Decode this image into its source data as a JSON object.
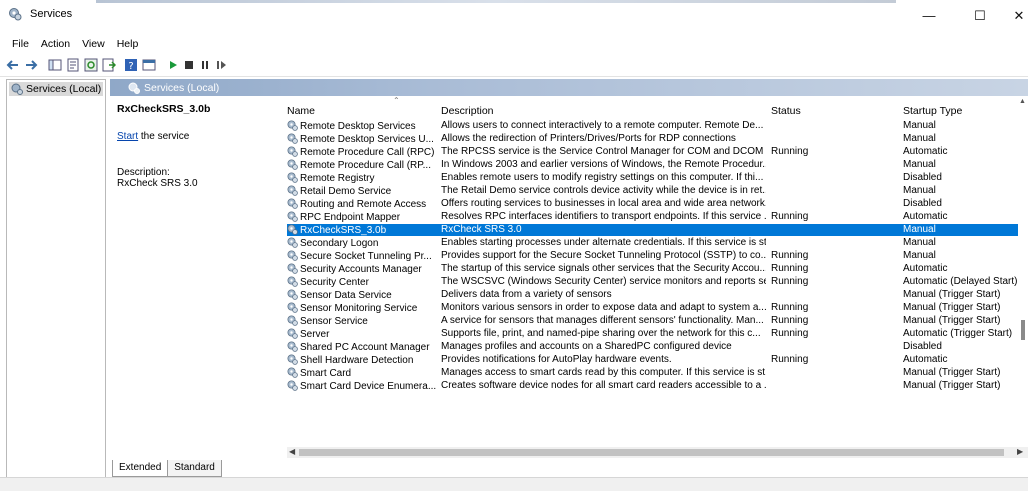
{
  "window": {
    "title": "Services"
  },
  "menu": [
    "File",
    "Action",
    "View",
    "Help"
  ],
  "tree": {
    "root": "Services (Local)"
  },
  "panel": {
    "header": "Services (Local)"
  },
  "details": {
    "service_name": "RxCheckSRS_3.0b",
    "action_link": "Start",
    "action_rest": " the service",
    "description_label": "Description:",
    "description_value": "RxCheck SRS 3.0"
  },
  "columns": {
    "name": "Name",
    "description": "Description",
    "status": "Status",
    "startup_type": "Startup Type"
  },
  "services": [
    {
      "name": "Remote Desktop Services",
      "description": "Allows users to connect interactively to a remote computer. Remote De...",
      "status": "",
      "startup": "Manual"
    },
    {
      "name": "Remote Desktop Services U...",
      "description": "Allows the redirection of Printers/Drives/Ports for RDP connections",
      "status": "",
      "startup": "Manual"
    },
    {
      "name": "Remote Procedure Call (RPC)",
      "description": "The RPCSS service is the Service Control Manager for COM and DCOM s...",
      "status": "Running",
      "startup": "Automatic"
    },
    {
      "name": "Remote Procedure Call (RP...",
      "description": "In Windows 2003 and earlier versions of Windows, the Remote Procedur...",
      "status": "",
      "startup": "Manual"
    },
    {
      "name": "Remote Registry",
      "description": "Enables remote users to modify registry settings on this computer. If thi...",
      "status": "",
      "startup": "Disabled"
    },
    {
      "name": "Retail Demo Service",
      "description": "The Retail Demo service controls device activity while the device is in ret...",
      "status": "",
      "startup": "Manual"
    },
    {
      "name": "Routing and Remote Access",
      "description": "Offers routing services to businesses in local area and wide area network...",
      "status": "",
      "startup": "Disabled"
    },
    {
      "name": "RPC Endpoint Mapper",
      "description": "Resolves RPC interfaces identifiers to transport endpoints. If this service ...",
      "status": "Running",
      "startup": "Automatic"
    },
    {
      "name": "RxCheckSRS_3.0b",
      "description": "RxCheck SRS 3.0",
      "status": "",
      "startup": "Manual",
      "selected": true
    },
    {
      "name": "Secondary Logon",
      "description": "Enables starting processes under alternate credentials. If this service is st...",
      "status": "",
      "startup": "Manual"
    },
    {
      "name": "Secure Socket Tunneling Pr...",
      "description": "Provides support for the Secure Socket Tunneling Protocol (SSTP) to co...",
      "status": "Running",
      "startup": "Manual"
    },
    {
      "name": "Security Accounts Manager",
      "description": "The startup of this service signals other services that the Security Accou...",
      "status": "Running",
      "startup": "Automatic"
    },
    {
      "name": "Security Center",
      "description": "The WSCSVC (Windows Security Center) service monitors and reports se...",
      "status": "Running",
      "startup": "Automatic (Delayed Start)"
    },
    {
      "name": "Sensor Data Service",
      "description": "Delivers data from a variety of sensors",
      "status": "",
      "startup": "Manual (Trigger Start)"
    },
    {
      "name": "Sensor Monitoring Service",
      "description": "Monitors various sensors in order to expose data and adapt to system a...",
      "status": "Running",
      "startup": "Manual (Trigger Start)"
    },
    {
      "name": "Sensor Service",
      "description": "A service for sensors that manages different sensors' functionality. Man...",
      "status": "Running",
      "startup": "Manual (Trigger Start)"
    },
    {
      "name": "Server",
      "description": "Supports file, print, and named-pipe sharing over the network for this c...",
      "status": "Running",
      "startup": "Automatic (Trigger Start)"
    },
    {
      "name": "Shared PC Account Manager",
      "description": "Manages profiles and accounts on a SharedPC configured device",
      "status": "",
      "startup": "Disabled"
    },
    {
      "name": "Shell Hardware Detection",
      "description": "Provides notifications for AutoPlay hardware events.",
      "status": "Running",
      "startup": "Automatic"
    },
    {
      "name": "Smart Card",
      "description": "Manages access to smart cards read by this computer. If this service is st...",
      "status": "",
      "startup": "Manual (Trigger Start)"
    },
    {
      "name": "Smart Card Device Enumera...",
      "description": "Creates software device nodes for all smart card readers accessible to a ...",
      "status": "",
      "startup": "Manual (Trigger Start)"
    }
  ],
  "tabs": [
    "Extended",
    "Standard"
  ],
  "colors": {
    "selection": "#0078d7",
    "link": "#0645ad",
    "header_gradient_start": "#8fa8c8"
  }
}
